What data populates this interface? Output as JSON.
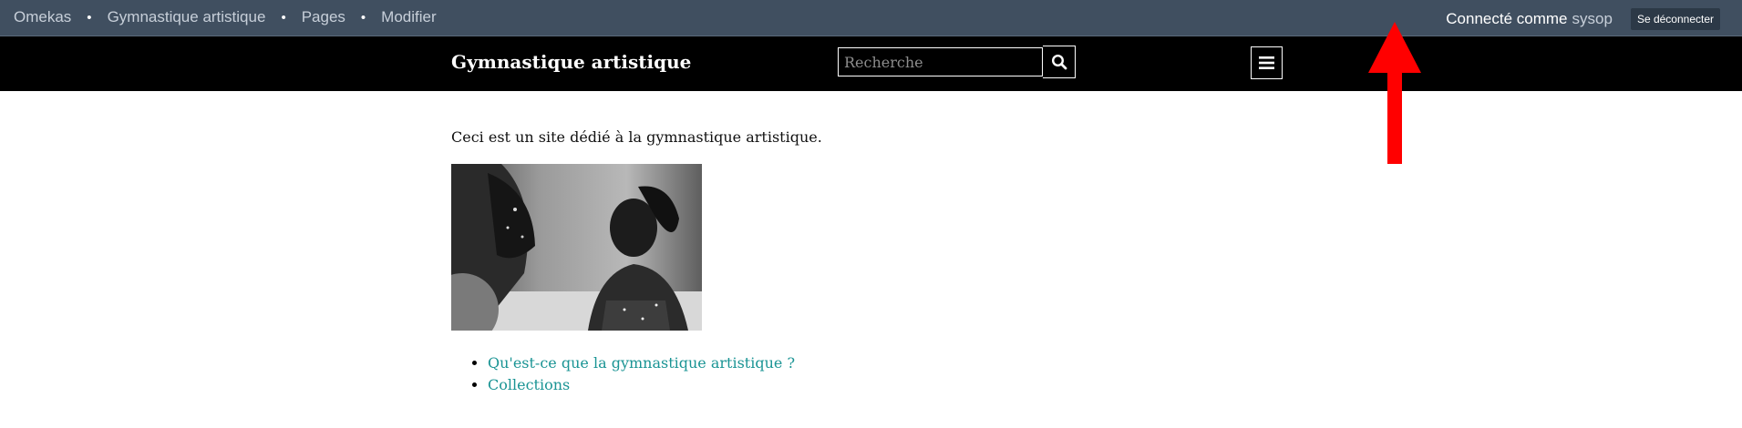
{
  "admin_bar": {
    "breadcrumbs": [
      "Omekas",
      "Gymnastique artistique",
      "Pages",
      "Modifier"
    ],
    "separator": "•",
    "connected_label": "Connecté comme",
    "username": "sysop",
    "logout_label": "Se déconnecter"
  },
  "header": {
    "site_title": "Gymnastique artistique",
    "search_placeholder": "Recherche",
    "search_icon": "search-icon",
    "menu_icon": "hamburger-icon"
  },
  "content": {
    "intro": "Ceci est un site dédié à la gymnastique artistique.",
    "links": [
      "Qu'est-ce que la gymnastique artistique ?",
      "Collections"
    ]
  },
  "colors": {
    "admin_bar": "#404f60",
    "header": "#000000",
    "link": "#1a9494",
    "arrow": "#ff0000"
  }
}
